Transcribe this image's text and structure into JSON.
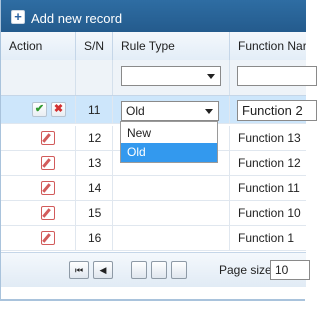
{
  "toolbar": {
    "add_label": "Add new record",
    "add_icon": "plus-icon"
  },
  "columns": {
    "action": "Action",
    "sn": "S/N",
    "rule_type": "Rule Type",
    "function_name": "Function Nar"
  },
  "filter": {
    "rule_type_value": "",
    "function_name_value": ""
  },
  "edit_row": {
    "sn": "11",
    "rule_type": "Old",
    "function_name": "Function 2",
    "ok_icon": "✔",
    "cancel_icon": "✖"
  },
  "rows": [
    {
      "sn": "12",
      "function_name": "Function 13"
    },
    {
      "sn": "13",
      "function_name": "Function 12"
    },
    {
      "sn": "14",
      "function_name": "Function 11"
    },
    {
      "sn": "15",
      "function_name": "Function 10"
    },
    {
      "sn": "16",
      "function_name": "Function 1"
    }
  ],
  "dropdown": {
    "options": [
      "New",
      "Old"
    ],
    "selected": "Old"
  },
  "pager": {
    "first_icon": "⏮",
    "prev_icon": "◀",
    "page_size_label": "Page size:",
    "page_size_value": "10"
  }
}
